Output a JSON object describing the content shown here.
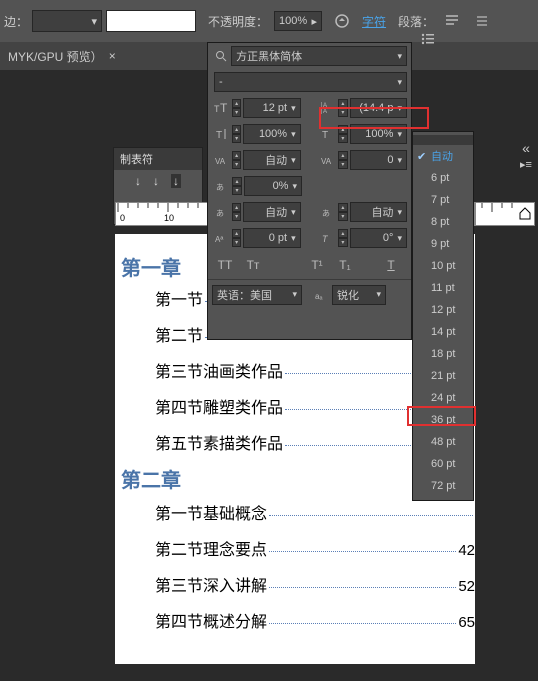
{
  "topbar": {
    "stroke_label": "边：",
    "opacity_label": "不透明度：",
    "opacity_value": "100%",
    "char_tab": "字符",
    "para_tab": "段落："
  },
  "doctab": {
    "label": "MYK/GPU 预览）"
  },
  "tabstops_panel": {
    "title": "制表符"
  },
  "ruler": {
    "ticks": [
      "0",
      "10"
    ]
  },
  "char_panel": {
    "font_family": "方正黑体简体",
    "font_style": "-",
    "font_size": "12 pt",
    "leading": "(14.4 p",
    "h_scale": "100%",
    "v_scale": "100%",
    "kerning": "自动",
    "tracking": "0",
    "baseline_shift": "0%",
    "rotation_row_left": "自动",
    "rotation_row_right": "自动",
    "xoffset": "0 pt",
    "angle": "0°",
    "lang": "英语：美国",
    "aa": "锐化"
  },
  "leading_options": {
    "auto": "自动",
    "items": [
      "6 pt",
      "7 pt",
      "8 pt",
      "9 pt",
      "10 pt",
      "11 pt",
      "12 pt",
      "14 pt",
      "18 pt",
      "21 pt",
      "24 pt",
      "36 pt",
      "48 pt",
      "60 pt",
      "72 pt"
    ]
  },
  "doc": {
    "chapter1": "第一章",
    "c1_items": [
      {
        "title": "第一节",
        "page": ""
      },
      {
        "title": "第二节",
        "page": ""
      },
      {
        "title": "第三节油画类作品",
        "page": ""
      },
      {
        "title": "第四节雕塑类作品",
        "page": ""
      },
      {
        "title": "第五节素描类作品",
        "page": ""
      }
    ],
    "chapter2": "第二章",
    "c2_items": [
      {
        "title": "第一节基础概念",
        "page": ""
      },
      {
        "title": "第二节理念要点",
        "page": "42"
      },
      {
        "title": "第三节深入讲解",
        "page": "52"
      },
      {
        "title": "第四节概述分解",
        "page": "65"
      }
    ]
  },
  "chart_data": null
}
